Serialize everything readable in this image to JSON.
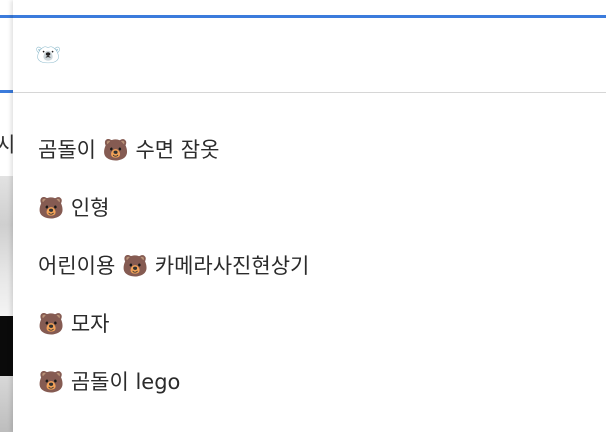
{
  "background": {
    "partial_char": "시"
  },
  "search": {
    "value": "🐻‍❄️"
  },
  "suggestions": [
    {
      "text": "곰돌이 🐻 수면 잠옷"
    },
    {
      "text": "🐻 인형"
    },
    {
      "text": "어린이용 🐻 카메라사진현상기"
    },
    {
      "text": "🐻 모자"
    },
    {
      "text": "🐻 곰돌이 lego"
    }
  ],
  "colors": {
    "accent": "#3b7bdc",
    "divider": "#d6d6d6",
    "text": "#2b2b2b"
  }
}
